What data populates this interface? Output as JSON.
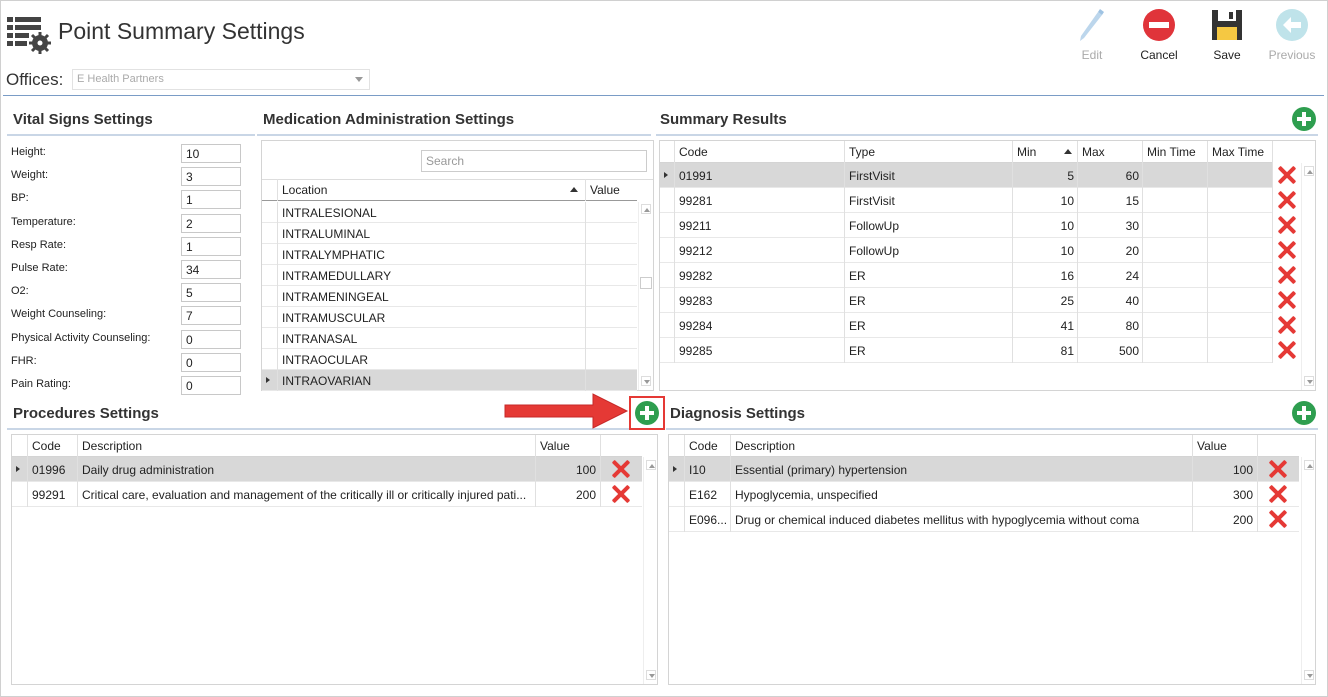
{
  "header": {
    "title": "Point Summary Settings",
    "offices_label": "Offices:",
    "offices_value": "E Health Partners",
    "toolbar": {
      "edit": "Edit",
      "cancel": "Cancel",
      "save": "Save",
      "previous": "Previous"
    }
  },
  "vital_signs": {
    "title": "Vital Signs Settings",
    "fields": [
      {
        "label": "Height:",
        "value": "10"
      },
      {
        "label": "Weight:",
        "value": "3"
      },
      {
        "label": "BP:",
        "value": "1"
      },
      {
        "label": "Temperature:",
        "value": "2"
      },
      {
        "label": "Resp Rate:",
        "value": "1"
      },
      {
        "label": "Pulse Rate:",
        "value": "34"
      },
      {
        "label": "O2:",
        "value": "5"
      },
      {
        "label": "Weight Counseling:",
        "value": "7"
      },
      {
        "label": "Physical Activity Counseling:",
        "value": "0"
      },
      {
        "label": "FHR:",
        "value": "0"
      },
      {
        "label": "Pain Rating:",
        "value": "0"
      }
    ]
  },
  "medication": {
    "title": "Medication Administration Settings",
    "search_placeholder": "Search",
    "columns": {
      "location": "Location",
      "value": "Value"
    },
    "rows": [
      "INTRALESIONAL",
      "INTRALUMINAL",
      "INTRALYMPHATIC",
      "INTRAMEDULLARY",
      "INTRAMENINGEAL",
      "INTRAMUSCULAR",
      "INTRANASAL",
      "INTRAOCULAR",
      "INTRAOVARIAN"
    ]
  },
  "summary": {
    "title": "Summary Results",
    "columns": {
      "code": "Code",
      "type": "Type",
      "min": "Min",
      "max": "Max",
      "min_time": "Min Time",
      "max_time": "Max Time"
    },
    "rows": [
      {
        "code": "01991",
        "type": "FirstVisit",
        "min": "5",
        "max": "60"
      },
      {
        "code": "99281",
        "type": "FirstVisit",
        "min": "10",
        "max": "15"
      },
      {
        "code": "99211",
        "type": "FollowUp",
        "min": "10",
        "max": "30"
      },
      {
        "code": "99212",
        "type": "FollowUp",
        "min": "10",
        "max": "20"
      },
      {
        "code": "99282",
        "type": "ER",
        "min": "16",
        "max": "24"
      },
      {
        "code": "99283",
        "type": "ER",
        "min": "25",
        "max": "40"
      },
      {
        "code": "99284",
        "type": "ER",
        "min": "41",
        "max": "80"
      },
      {
        "code": "99285",
        "type": "ER",
        "min": "81",
        "max": "500"
      }
    ]
  },
  "procedures": {
    "title": "Procedures Settings",
    "columns": {
      "code": "Code",
      "description": "Description",
      "value": "Value"
    },
    "rows": [
      {
        "code": "01996",
        "description": "Daily drug administration",
        "value": "100"
      },
      {
        "code": "99291",
        "description": "Critical care, evaluation and management of the critically ill or critically injured pati...",
        "value": "200"
      }
    ]
  },
  "diagnosis": {
    "title": "Diagnosis Settings",
    "columns": {
      "code": "Code",
      "description": "Description",
      "value": "Value"
    },
    "rows": [
      {
        "code": "I10",
        "description": "Essential (primary) hypertension",
        "value": "100"
      },
      {
        "code": "E162",
        "description": "Hypoglycemia, unspecified",
        "value": "300"
      },
      {
        "code": "E096...",
        "description": "Drug or chemical induced diabetes mellitus with hypoglycemia without coma",
        "value": "200"
      }
    ]
  },
  "colors": {
    "accent_green": "#2e9e4f",
    "delete_red": "#e53935",
    "selected_row": "#d8d8d8",
    "header_rule": "#7a9cc6"
  }
}
